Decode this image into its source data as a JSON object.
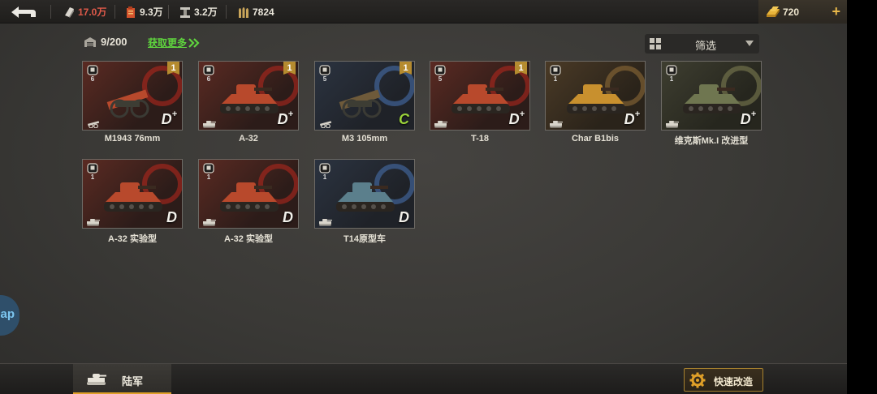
{
  "topbar": {
    "resources": [
      {
        "icon": "silver-ingot-icon",
        "value": "17.0万",
        "color": "#e05a4a"
      },
      {
        "icon": "fuel-can-icon",
        "value": "9.3万",
        "color": "#e9e5da"
      },
      {
        "icon": "steel-beam-icon",
        "value": "3.2万",
        "color": "#e9e5da"
      },
      {
        "icon": "ammo-shells-icon",
        "value": "7824",
        "color": "#e9e5da"
      }
    ],
    "gold": {
      "icon": "gold-bar-icon",
      "value": "720"
    }
  },
  "storage": {
    "count": "9/200"
  },
  "get_more": "获取更多",
  "filter": {
    "label": "筛选"
  },
  "cards": [
    {
      "name": "M1943 76mm",
      "level": "6",
      "star": "1",
      "grade": "D",
      "plus": "+",
      "grade_color": "white",
      "type": "artillery",
      "theme": "red"
    },
    {
      "name": "A-32",
      "level": "6",
      "star": "1",
      "grade": "D",
      "plus": "+",
      "grade_color": "white",
      "type": "tank",
      "theme": "red"
    },
    {
      "name": "M3 105mm",
      "level": "5",
      "star": "1",
      "grade": "C",
      "plus": "",
      "grade_color": "green",
      "type": "artillery",
      "theme": "blue"
    },
    {
      "name": "T-18",
      "level": "5",
      "star": "1",
      "grade": "D",
      "plus": "+",
      "grade_color": "white",
      "type": "tank",
      "theme": "red"
    },
    {
      "name": "Char B1bis",
      "level": "1",
      "star": "",
      "grade": "D",
      "plus": "+",
      "grade_color": "white",
      "type": "tank",
      "theme": "brown"
    },
    {
      "name": "维克斯Mk.I 改进型",
      "level": "1",
      "star": "",
      "grade": "D",
      "plus": "+",
      "grade_color": "white",
      "type": "tank",
      "theme": "olive"
    },
    {
      "name": "A-32 实验型",
      "level": "1",
      "star": "",
      "grade": "D",
      "plus": "",
      "grade_color": "white",
      "type": "tank",
      "theme": "red"
    },
    {
      "name": "A-32 实验型",
      "level": "1",
      "star": "",
      "grade": "D",
      "plus": "",
      "grade_color": "white",
      "type": "tank",
      "theme": "red"
    },
    {
      "name": "T14原型车",
      "level": "1",
      "star": "",
      "grade": "D",
      "plus": "",
      "grade_color": "white",
      "type": "tank",
      "theme": "blue"
    }
  ],
  "bottom": {
    "tab_army": "陆军",
    "quick_upgrade": "快速改造"
  },
  "side_bubble": "ap",
  "colors": {
    "accent_gold": "#e0a028",
    "get_more_green": "#5fd43e",
    "grade_c_green": "#9ad23a"
  }
}
